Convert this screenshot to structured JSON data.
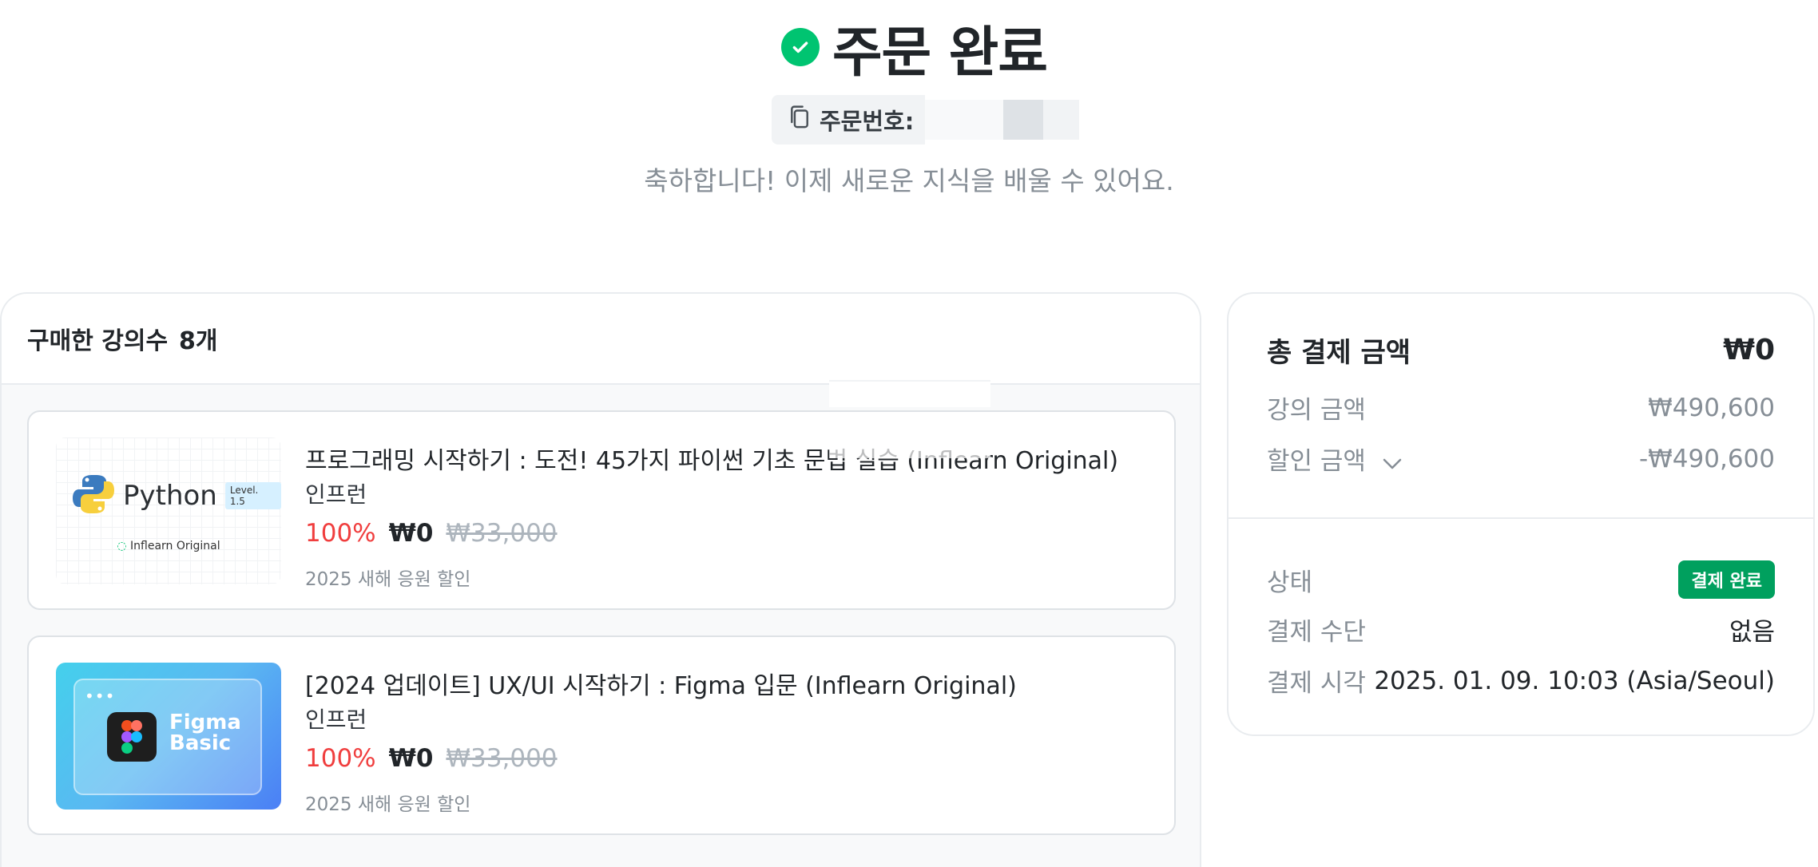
{
  "header": {
    "title": "주문 완료",
    "order_number_label": "주문번호:",
    "congrats": "축하합니다! 이제 새로운 지식을 배울 수 있어요."
  },
  "purchased": {
    "label": "구매한 강의수",
    "count": "8개"
  },
  "courses": [
    {
      "title": "프로그래밍 시작하기 : 도전! 45가지 파이썬 기초 문법 실습 (Inflearn Original)",
      "instructor": "인프런",
      "discount": "100%",
      "price": "₩0",
      "original_price": "₩33,000",
      "promo": "2025 새해 응원 할인",
      "thumb": {
        "name": "Python",
        "level": "Level. 1.5",
        "sub": "Inflearn Original"
      }
    },
    {
      "title": "[2024 업데이트] UX/UI 시작하기 : Figma 입문 (Inflearn Original)",
      "instructor": "인프런",
      "discount": "100%",
      "price": "₩0",
      "original_price": "₩33,000",
      "promo": "2025 새해 응원 할인",
      "thumb": {
        "line1": "Figma",
        "line2": "Basic",
        "dots": "•••"
      }
    }
  ],
  "summary": {
    "total_label": "총 결제 금액",
    "total_value": "₩0",
    "course_amount_label": "강의 금액",
    "course_amount_value": "₩490,600",
    "discount_label": "할인 금액",
    "discount_value": "-₩490,600",
    "status_label": "상태",
    "status_value": "결제 완료",
    "method_label": "결제 수단",
    "method_value": "없음",
    "time_label": "결제 시각",
    "time_value": "2025. 01. 09. 10:03 (Asia/Seoul)"
  },
  "colors": {
    "success": "#00c471",
    "badge": "#00a05e",
    "discount_red": "#f03e3e",
    "muted": "#868e96"
  },
  "icons": [
    "check-circle-icon",
    "copy-icon",
    "chevron-down-icon",
    "python-logo-icon",
    "figma-logo-icon"
  ]
}
